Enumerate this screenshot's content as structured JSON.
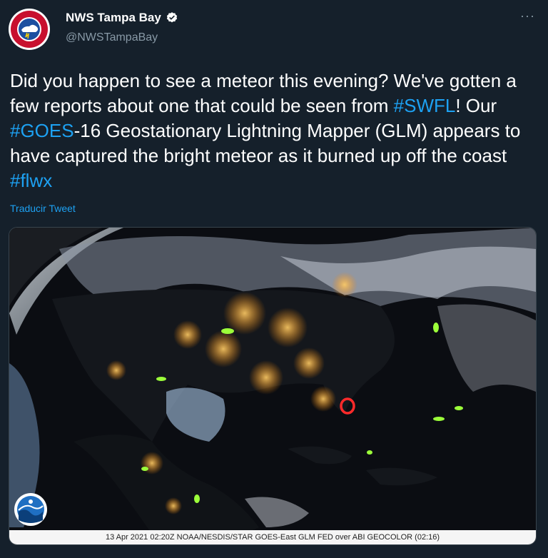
{
  "account": {
    "display_name": "NWS Tampa Bay",
    "handle": "@NWSTampaBay",
    "avatar_icon": "nws-logo-icon",
    "verified_icon": "verified-badge-icon"
  },
  "menu": {
    "more_label": "···"
  },
  "tweet": {
    "segments": [
      {
        "text": "Did you happen to see a meteor this evening? We've gotten a few reports about one that could be seen from ",
        "type": "text"
      },
      {
        "text": "#SWFL",
        "type": "hashtag"
      },
      {
        "text": "! Our ",
        "type": "text"
      },
      {
        "text": "#GOES",
        "type": "hashtag"
      },
      {
        "text": "-16 Geostationary Lightning Mapper (GLM) appears to have captured the bright meteor as it burned up off the coast ",
        "type": "text"
      },
      {
        "text": "#flwx",
        "type": "hashtag"
      }
    ],
    "translate_label": "Traducir Tweet"
  },
  "media": {
    "caption": "13 Apr 2021 02:20Z NOAA/NESDIS/STAR GOES-East GLM FED over ABI GEOCOLOR (02:16)",
    "logo_icon": "noaa-logo-icon",
    "highlight_color": "#ff2a2a",
    "lightning_color": "#9cff3a"
  },
  "colors": {
    "background": "#15202b",
    "link": "#1da1f2",
    "muted": "#8899a6"
  }
}
